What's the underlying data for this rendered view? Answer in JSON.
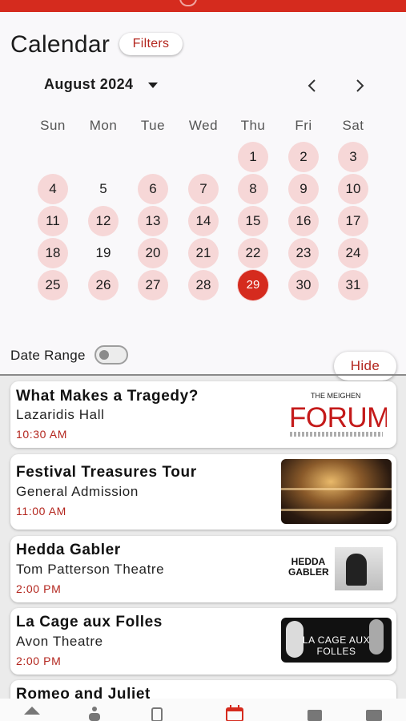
{
  "header": {
    "title": "Calendar",
    "filters_label": "Filters"
  },
  "calendar": {
    "month_label": "August 2024",
    "weekdays": [
      "Sun",
      "Mon",
      "Tue",
      "Wed",
      "Thu",
      "Fri",
      "Sat"
    ],
    "selected_day": "29",
    "days_with_events": [
      "1",
      "2",
      "3",
      "4",
      "6",
      "7",
      "8",
      "9",
      "10",
      "11",
      "12",
      "13",
      "14",
      "15",
      "16",
      "17",
      "18",
      "20",
      "21",
      "22",
      "23",
      "24",
      "25",
      "26",
      "27",
      "28",
      "30",
      "31"
    ],
    "days": [
      "1",
      "2",
      "3",
      "4",
      "5",
      "6",
      "7",
      "8",
      "9",
      "10",
      "11",
      "12",
      "13",
      "14",
      "15",
      "16",
      "17",
      "18",
      "19",
      "20",
      "21",
      "22",
      "23",
      "24",
      "25",
      "26",
      "27",
      "28",
      "29",
      "30",
      "31"
    ]
  },
  "controls": {
    "date_range_label": "Date Range",
    "date_range_on": false,
    "hide_label": "Hide"
  },
  "events": [
    {
      "title": "What Makes a Tragedy?",
      "venue": "Lazaridis Hall",
      "time": "10:30 AM",
      "thumb": {
        "top_text": "THE MEIGHEN",
        "main_text": "FORUM"
      }
    },
    {
      "title": "Festival Treasures Tour",
      "venue": "General Admission",
      "time": "11:00 AM"
    },
    {
      "title": "Hedda Gabler",
      "venue": "Tom Patterson Theatre",
      "time": "2:00 PM",
      "thumb": {
        "main_text": "HEDDA GABLER"
      }
    },
    {
      "title": "La Cage aux Folles",
      "venue": "Avon Theatre",
      "time": "2:00 PM",
      "thumb": {
        "main_text": "LA CAGE AUX FOLLES"
      }
    },
    {
      "title": "Romeo and Juliet"
    }
  ],
  "colors": {
    "accent": "#d52b1e",
    "event_day": "#f6d7d7",
    "link": "#b3261e"
  },
  "bottom_nav": {
    "icons": [
      "home-icon",
      "person-icon",
      "ticket-icon",
      "calendar-icon",
      "info-icon",
      "more-icon"
    ],
    "active": "calendar-icon"
  }
}
